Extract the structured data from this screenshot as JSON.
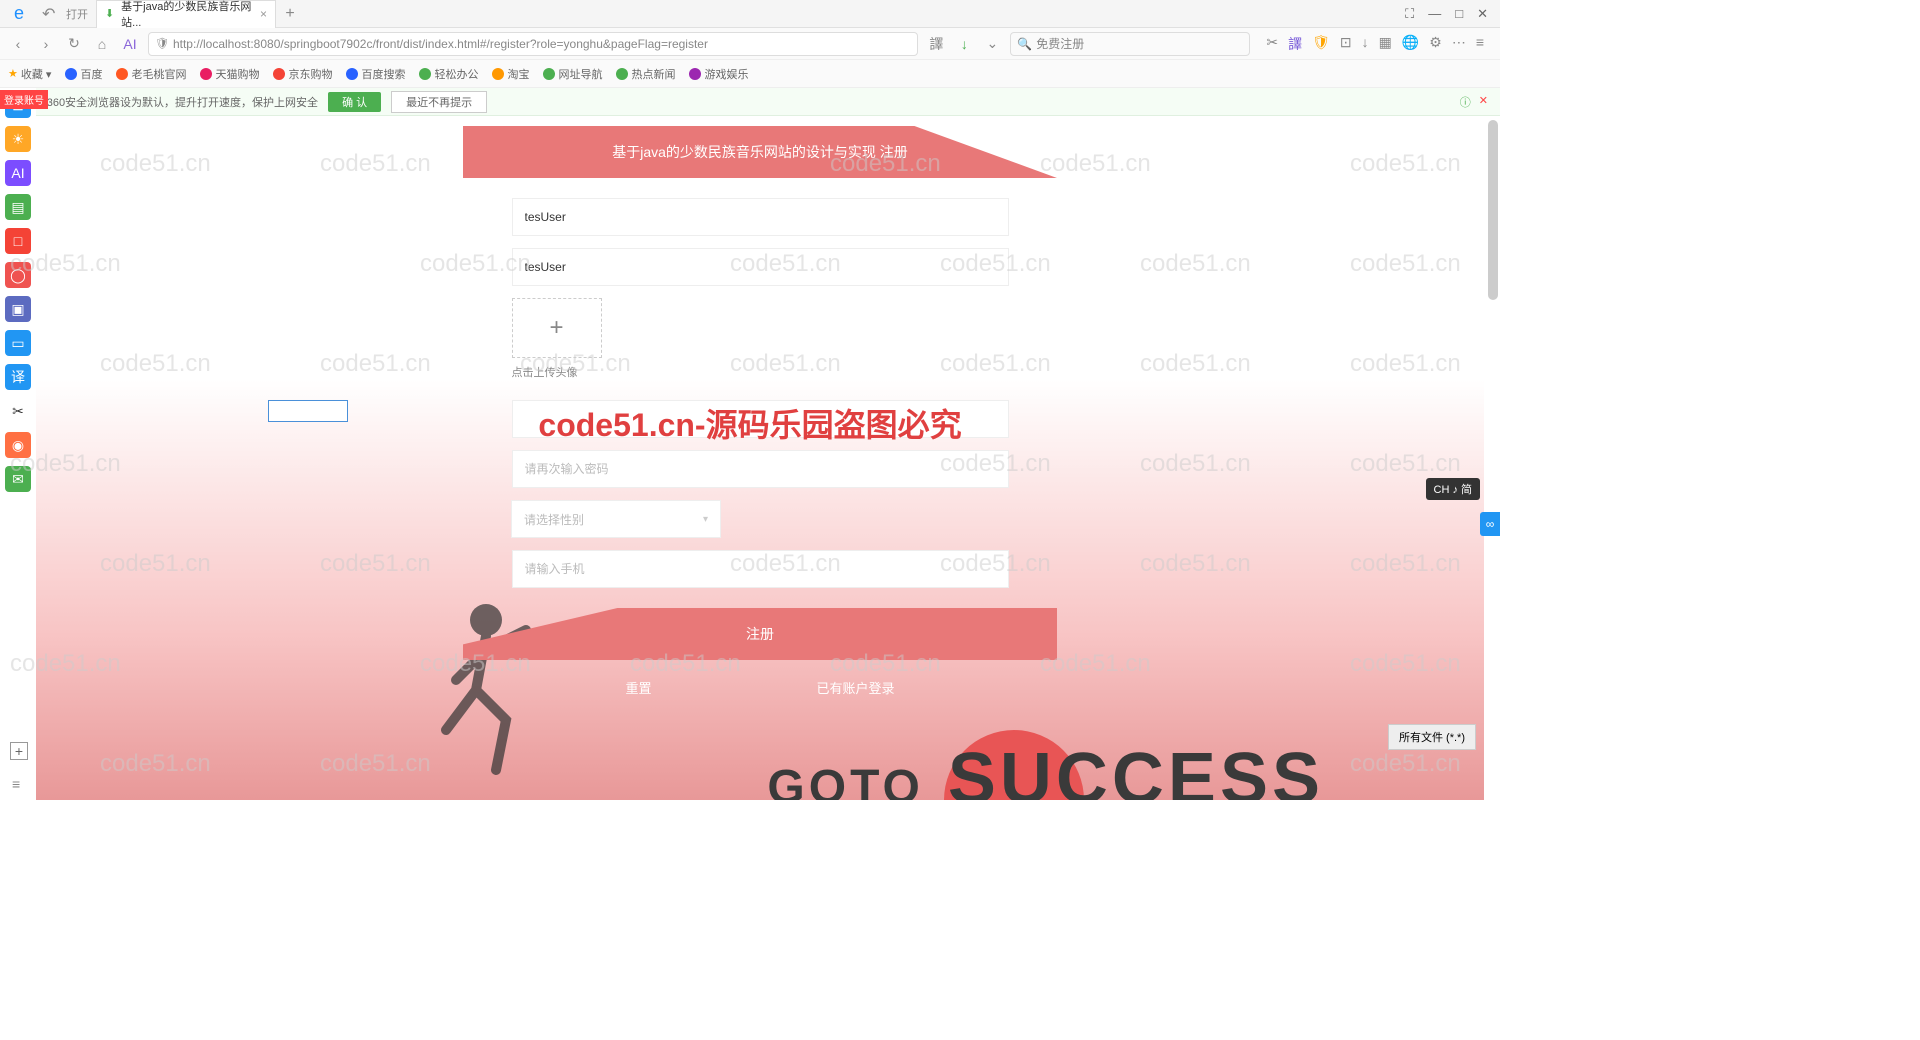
{
  "browser": {
    "open_label": "打开",
    "tab_title": "基于java的少数民族音乐网站...",
    "url": "http://localhost:8080/springboot7902c/front/dist/index.html#/register?role=yonghu&pageFlag=register",
    "search_placeholder": "免费注册",
    "min": "—",
    "max": "□",
    "close": "✕"
  },
  "bookmarks": {
    "fav": "收藏 ▾",
    "items": [
      "百度",
      "老毛桃官网",
      "天猫购物",
      "京东购物",
      "百度搜索",
      "轻松办公",
      "淘宝",
      "网址导航",
      "热点新闻",
      "游戏娱乐"
    ]
  },
  "notice": {
    "text": "将360安全浏览器设为默认，提升打开速度，保护上网安全",
    "confirm": "确 认",
    "dismiss": "最近不再提示"
  },
  "form": {
    "title": "基于java的少数民族音乐网站的设计与实现 注册",
    "username_value": "tesUser",
    "name_value": "tesUser",
    "upload_label": "点击上传头像",
    "password2_placeholder": "请再次输入密码",
    "gender_placeholder": "请选择性别",
    "phone_placeholder": "请输入手机",
    "register_btn": "注册",
    "reset_link": "重置",
    "login_link": "已有账户登录"
  },
  "bg": {
    "goto": "GOTO",
    "success": "SUCCESS"
  },
  "watermark": {
    "text": "code51.cn",
    "red_text": "code51.cn-源码乐园盗图必究"
  },
  "badges": {
    "login": "登录账号",
    "ime": "CH ♪ 简",
    "files": "所有文件 (*.*)"
  }
}
